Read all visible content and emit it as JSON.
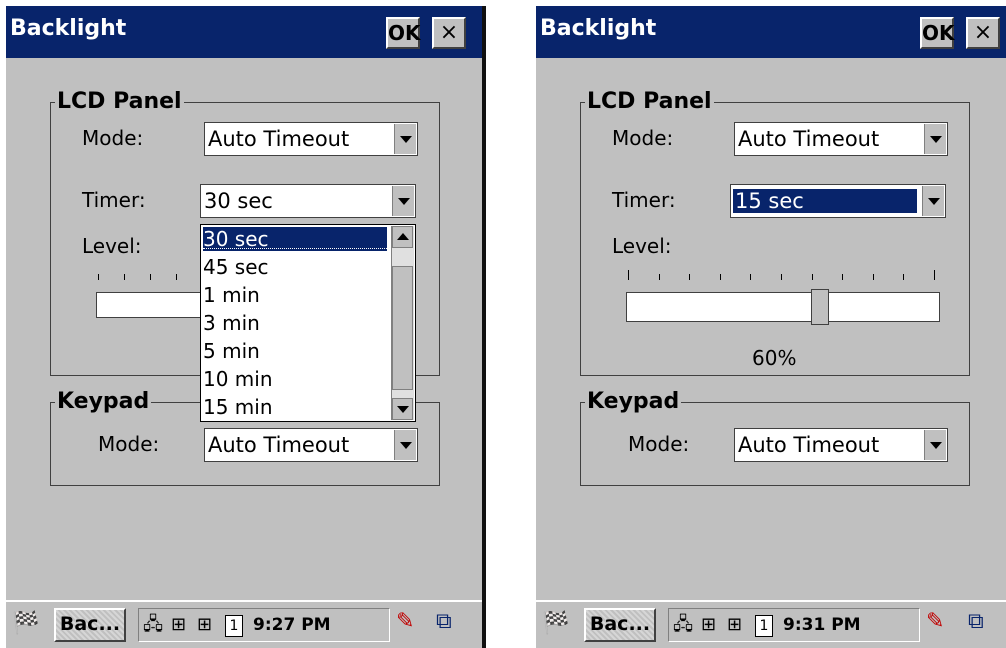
{
  "colors": {
    "titlebar": "#08246b",
    "window_bg": "#c0c0c0",
    "selection": "#08246b"
  },
  "screens": [
    {
      "title": "Backlight",
      "ok_label": "OK",
      "close_label": "×",
      "lcd": {
        "group_label": "LCD Panel",
        "mode_label": "Mode:",
        "mode_value": "Auto Timeout",
        "timer_label": "Timer:",
        "timer_value": "30 sec",
        "level_label": "Level:"
      },
      "timer_dropdown": {
        "open": true,
        "selected": "30 sec",
        "options": [
          "30 sec",
          "45 sec",
          "1 min",
          "3 min",
          "5 min",
          "10 min",
          "15 min"
        ]
      },
      "keypad": {
        "group_label": "Keypad",
        "mode_label": "Mode:",
        "mode_value": "Auto Timeout"
      },
      "taskbar": {
        "start_icon": "windows-flag-icon",
        "task_label": "Bac...",
        "tray_icons": [
          "network-icon",
          "input-icon",
          "input-icon",
          "number-icon"
        ],
        "tray_number": "1",
        "time": "9:27 PM"
      }
    },
    {
      "title": "Backlight",
      "ok_label": "OK",
      "close_label": "×",
      "lcd": {
        "group_label": "LCD Panel",
        "mode_label": "Mode:",
        "mode_value": "Auto Timeout",
        "timer_label": "Timer:",
        "timer_value": "15 sec",
        "level_label": "Level:",
        "level_value": 0.6,
        "level_text": "60%"
      },
      "keypad": {
        "group_label": "Keypad",
        "mode_label": "Mode:",
        "mode_value": "Auto Timeout"
      },
      "taskbar": {
        "start_icon": "windows-flag-icon",
        "task_label": "Bac...",
        "tray_icons": [
          "network-icon",
          "input-icon",
          "input-icon",
          "number-icon"
        ],
        "tray_number": "1",
        "time": "9:31 PM"
      }
    }
  ]
}
